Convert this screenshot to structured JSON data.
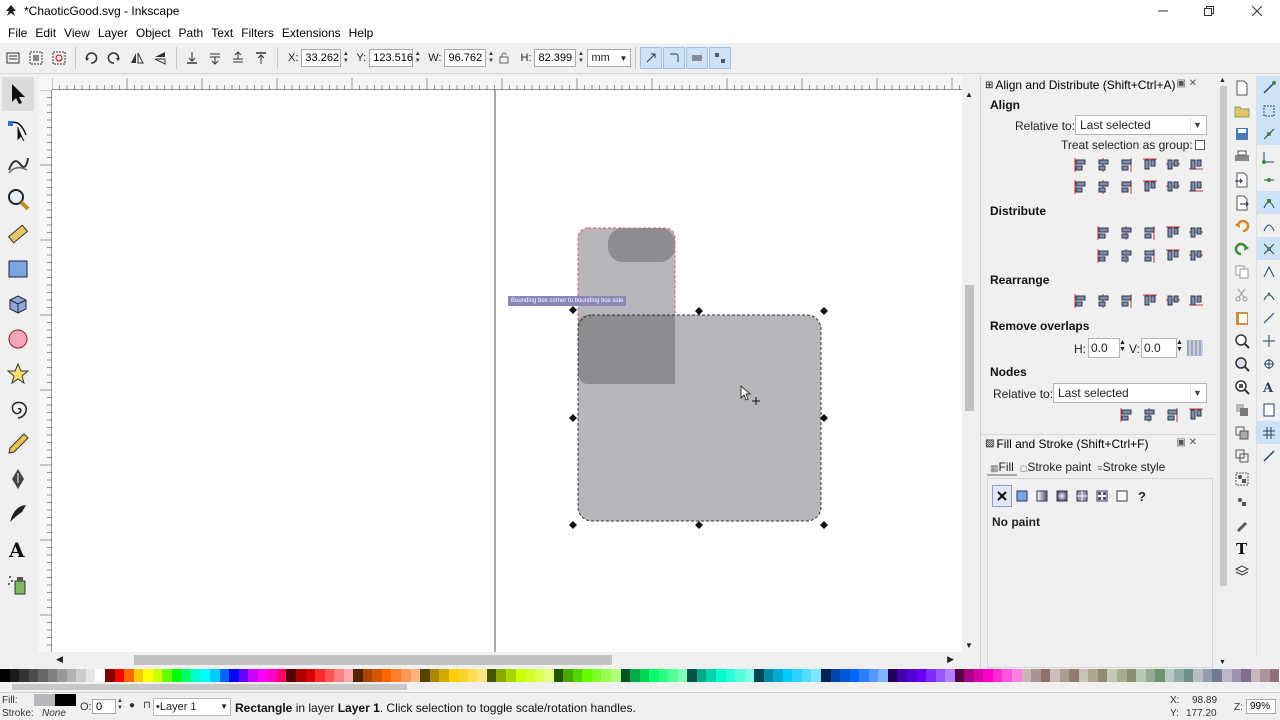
{
  "window": {
    "title": "*ChaoticGood.svg - Inkscape",
    "minimize_icon": "minimize-icon",
    "maximize_icon": "restore-icon",
    "close_icon": "close-icon"
  },
  "menu": [
    "File",
    "Edit",
    "View",
    "Layer",
    "Object",
    "Path",
    "Text",
    "Filters",
    "Extensions",
    "Help"
  ],
  "tool_controls": {
    "x_label": "X:",
    "x_value": "33.262",
    "y_label": "Y:",
    "y_value": "123.516",
    "w_label": "W:",
    "w_value": "96.762",
    "lock_icon": "lock-icon",
    "h_label": "H:",
    "h_value": "82.399",
    "unit": "mm"
  },
  "canvas": {
    "snap_tooltip": "Bounding box corner to bounding box side"
  },
  "align_dialog": {
    "title": "Align and Distribute (Shift+Ctrl+A)",
    "align_heading": "Align",
    "relative_label": "Relative to:",
    "relative_value": "Last selected",
    "treat_group_label": "Treat selection as group:",
    "distribute_heading": "Distribute",
    "rearrange_heading": "Rearrange",
    "remove_overlaps_heading": "Remove overlaps",
    "h_label": "H:",
    "h_value": "0.0",
    "v_label": "V:",
    "v_value": "0.0",
    "nodes_heading": "Nodes",
    "nodes_relative_label": "Relative to:",
    "nodes_relative_value": "Last selected"
  },
  "fill_stroke_dialog": {
    "title": "Fill and Stroke (Shift+Ctrl+F)",
    "tabs": [
      "Fill",
      "Stroke paint",
      "Stroke style"
    ],
    "no_paint_label": "No paint",
    "unknown_icon_label": "?"
  },
  "statusbar": {
    "fill_label": "Fill:",
    "stroke_label": "Stroke:",
    "stroke_value": "None",
    "opacity_label": "O:",
    "opacity_value": "0",
    "layer_value": "•Layer 1",
    "message_strong": "Rectangle",
    "message_middle": " in layer ",
    "message_layer": "Layer 1",
    "message_tail": ". Click selection to toggle scale/rotation handles.",
    "x_label": "X:",
    "x_value": "98.89",
    "y_label": "Y:",
    "y_value": "177.20",
    "z_label": "Z:",
    "zoom_value": "99%"
  },
  "palette_colors": [
    "#000000",
    "#1a1a1a",
    "#333333",
    "#4d4d4d",
    "#666666",
    "#808080",
    "#999999",
    "#b3b3b3",
    "#cccccc",
    "#e6e6e6",
    "#ffffff",
    "#800000",
    "#ff0000",
    "#ff6600",
    "#ffcc00",
    "#ffff00",
    "#ccff00",
    "#66ff00",
    "#00ff00",
    "#00ff66",
    "#00ffcc",
    "#00ffff",
    "#00ccff",
    "#0066ff",
    "#0000ff",
    "#6600ff",
    "#cc00ff",
    "#ff00ff",
    "#ff00cc",
    "#ff0066",
    "#550000",
    "#aa0000",
    "#d40000",
    "#ff2a2a",
    "#ff5555",
    "#ff8080",
    "#ffaaaa",
    "#552200",
    "#aa4400",
    "#d45500",
    "#ff6600",
    "#ff7f2a",
    "#ff9955",
    "#ffb380",
    "#554400",
    "#aa8800",
    "#d4aa00",
    "#ffcc00",
    "#ffd42a",
    "#ffdd55",
    "#ffe680",
    "#445500",
    "#88aa00",
    "#aad400",
    "#ccff00",
    "#d4ff2a",
    "#ddff55",
    "#e5ff80",
    "#225500",
    "#44aa00",
    "#55d400",
    "#66ff00",
    "#7fff2a",
    "#99ff55",
    "#b3ff80",
    "#005522",
    "#00aa44",
    "#00d455",
    "#00ff66",
    "#2aff80",
    "#55ff99",
    "#80ffb3",
    "#005544",
    "#00aa88",
    "#00d4aa",
    "#00ffcc",
    "#2affd5",
    "#55ffdd",
    "#80ffe6",
    "#004455",
    "#0088aa",
    "#00aad4",
    "#00ccff",
    "#2ad4ff",
    "#55ddff",
    "#80e5ff",
    "#002255",
    "#0044aa",
    "#0055d4",
    "#0066ff",
    "#2a7fff",
    "#5599ff",
    "#80b3ff",
    "#220055",
    "#4400aa",
    "#5500d4",
    "#6600ff",
    "#7f2aff",
    "#9955ff",
    "#b380ff",
    "#550044",
    "#aa0088",
    "#d400aa",
    "#ff00cc",
    "#ff2ad4",
    "#ff55dd",
    "#ff80e5",
    "#c8b7b7",
    "#ac9393",
    "#916f6f",
    "#c8beb7",
    "#ac9d93",
    "#917c6f",
    "#c8c4b7",
    "#aca793",
    "#918a6f",
    "#c4c8b7",
    "#a7ac93",
    "#8a916f",
    "#b7c8b7",
    "#93ac93",
    "#6f916f",
    "#b7c8c4",
    "#93aca7",
    "#6f918a",
    "#b7bec8",
    "#939dac",
    "#6f7c91",
    "#beb7c8",
    "#9d93ac",
    "#7c6f91",
    "#c8b7be",
    "#ac939d",
    "#916f7c"
  ]
}
